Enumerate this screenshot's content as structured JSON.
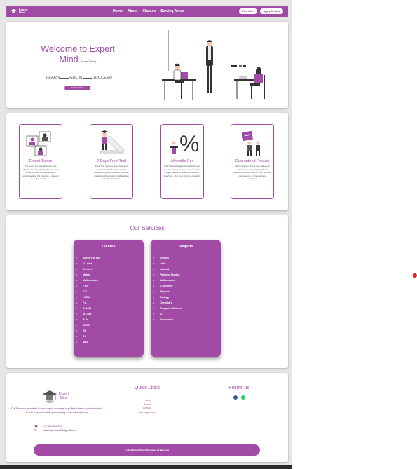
{
  "navbar": {
    "brand": "Expert Mind",
    "links": [
      "Home",
      "About",
      "Classes",
      "Serving Areas"
    ],
    "buttons": [
      "Find Now",
      "Apply As Now"
    ]
  },
  "hero": {
    "title": "Welcome to Expert Mind",
    "subtitle": "(Home Tutors)",
    "tagline": [
      "LEARN",
      "GROW",
      "SUCCEED"
    ],
    "cta": "Contact Now"
  },
  "features": [
    {
      "title": "Expert Tutors",
      "text": "Our tutors are specialized in their subjects and expert in guiding students to perform at their best level by understanding the capacity & interest of students."
    },
    {
      "title": "2 Days Free Trial",
      "text": "Free Trail Classes give chance to students to find best tutor match because only a compatible tutor can understand the student well and can solve the problems."
    },
    {
      "title": "Afforable Fee",
      "text": "Our Tutors charge reasonable fees to provide chance to maximum students to get benefit by availing individual coaching – the most effective learning."
    },
    {
      "title": "Guaranteed Results",
      "text": "Right choice of tutors can make you enhance your learning graphs or checked possible span of time. By shell competence on the quality of education."
    }
  ],
  "services": {
    "title": "Our Services",
    "classes_title": "Classes",
    "classes": [
      "Nursery to 8th",
      "O Level",
      "A Level",
      "Matric",
      "Mathematics",
      "F.Sc",
      "ICS",
      "I.COM",
      "F.A",
      "B.COM",
      "M.COM",
      "B.Sc",
      "BSCS",
      "BS",
      "BA",
      "MBA"
    ],
    "subjects_title": "Subjects",
    "subjects": [
      "English",
      "Urdu",
      "Islamiat",
      "Pakistan Studies",
      "Mathematics",
      "G. Science",
      "Physics",
      "Biology",
      "Chemistry",
      "Computer Science",
      "ICT",
      "Economics"
    ]
  },
  "footer": {
    "brand": "Expert Mind",
    "description": "Our Tutors are specialized in their subjects and expert in guiding students to perform at their best level by understanding the capacity & interest of students.",
    "phone": "+97 323-3044-780",
    "email": "hacabexpertmind99@gmail.com",
    "quick_title": "Quick Links",
    "quick_links": [
      "Home",
      "About",
      "Contact",
      "Serving Areas"
    ],
    "follow_title": "Follow us",
    "socials": [
      "facebook-icon",
      "whatsapp-icon"
    ],
    "copyright": "© 2024 Expert Mind | Designed by Slash.dk"
  },
  "colors": {
    "primary": "#a24ba6",
    "dark": "#6e2a72"
  }
}
